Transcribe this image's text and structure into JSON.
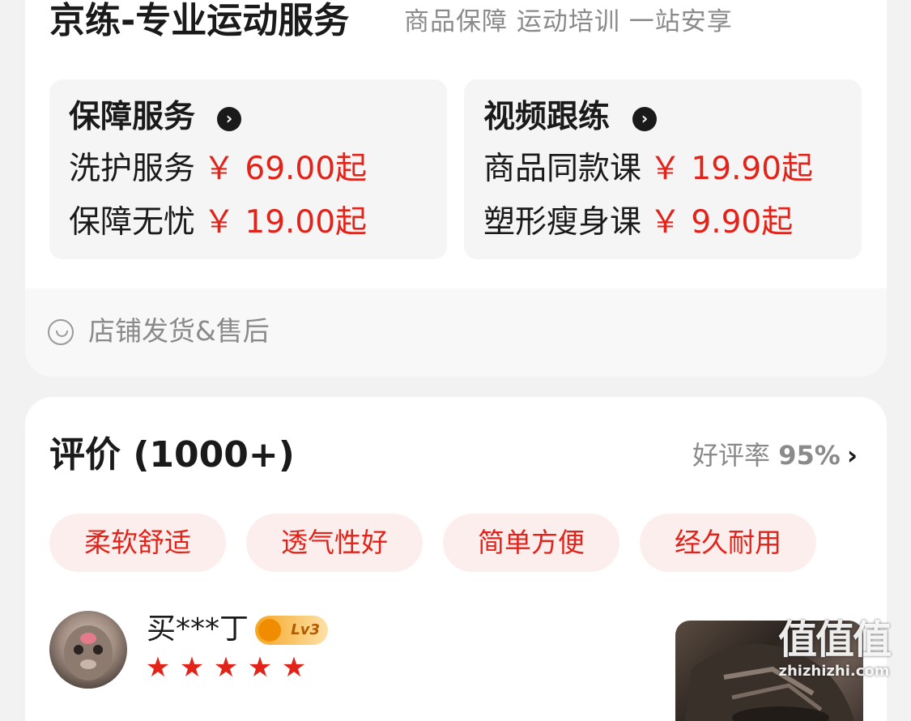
{
  "service_card": {
    "title": "京练-专业运动服务",
    "subtitle": "商品保障 运动培训 一站安享",
    "guarantee": {
      "title": "保障服务",
      "items": [
        {
          "label": "洗护服务",
          "price": "￥ 69.00起"
        },
        {
          "label": "保障无忧",
          "price": "￥ 19.00起"
        }
      ]
    },
    "video": {
      "title": "视频跟练",
      "items": [
        {
          "label": "商品同款课",
          "price": "￥ 19.90起"
        },
        {
          "label": "塑形瘦身课",
          "price": "￥ 9.90起"
        }
      ]
    },
    "store_note": "店铺发货&售后"
  },
  "reviews": {
    "title": "评价 (1000+)",
    "rate_label": "好评率",
    "rate_value": "95%",
    "tags": [
      "柔软舒适",
      "透气性好",
      "简单方便",
      "经久耐用"
    ],
    "first_review": {
      "user": "买***丁",
      "level_badge": "Lv3",
      "rating": 5
    }
  },
  "watermark": {
    "big": "值值值",
    "small": "zhizhizhi.com"
  },
  "colors": {
    "accent": "#e2231a",
    "tag_bg": "#fdeeee",
    "muted": "#8a8a8a"
  },
  "icons": {
    "arrow": "chevron-right-circle-icon",
    "store": "smile-icon",
    "star": "star-icon"
  }
}
